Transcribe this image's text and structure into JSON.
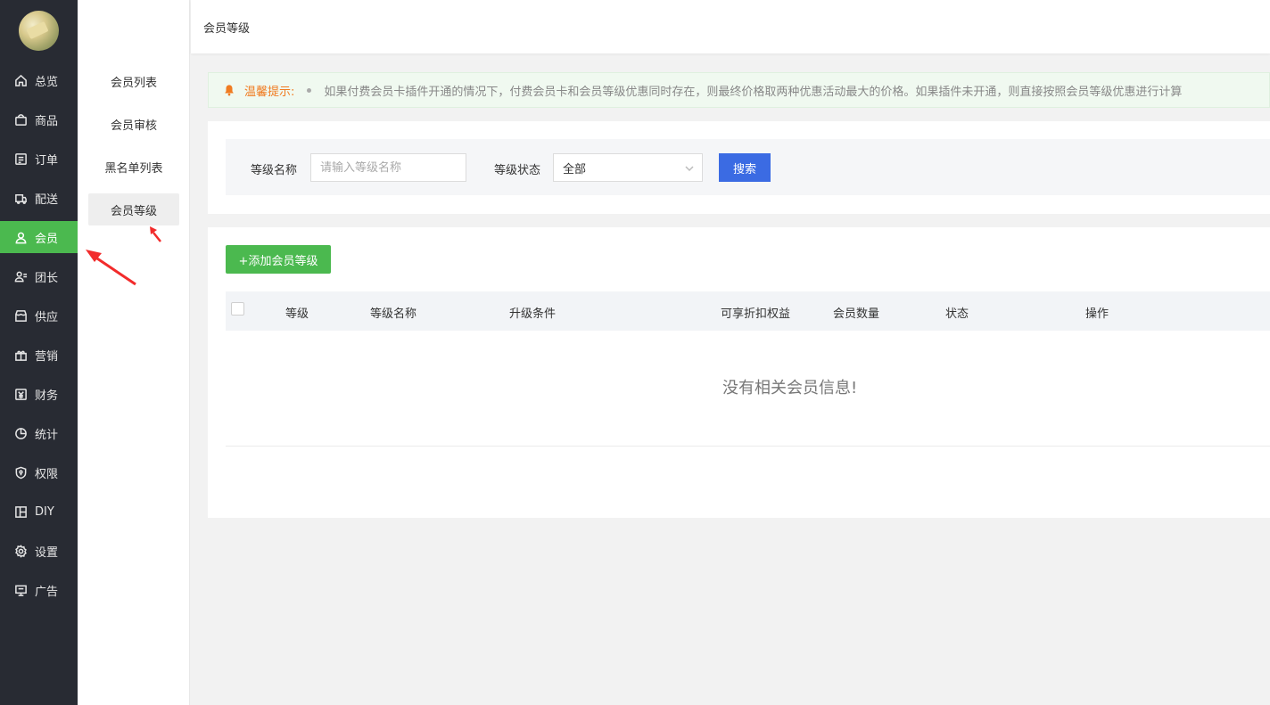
{
  "nav": {
    "items": [
      {
        "name": "overview",
        "label": "总览",
        "icon": "home-icon"
      },
      {
        "name": "goods",
        "label": "商品",
        "icon": "bag-icon"
      },
      {
        "name": "order",
        "label": "订单",
        "icon": "order-icon"
      },
      {
        "name": "delivery",
        "label": "配送",
        "icon": "delivery-icon"
      },
      {
        "name": "member",
        "label": "会员",
        "icon": "user-icon",
        "active": true
      },
      {
        "name": "leader",
        "label": "团长",
        "icon": "leader-icon"
      },
      {
        "name": "supply",
        "label": "供应",
        "icon": "store-icon"
      },
      {
        "name": "marketing",
        "label": "营销",
        "icon": "gift-icon"
      },
      {
        "name": "finance",
        "label": "财务",
        "icon": "yen-icon"
      },
      {
        "name": "stats",
        "label": "统计",
        "icon": "pie-icon"
      },
      {
        "name": "permission",
        "label": "权限",
        "icon": "shield-icon"
      },
      {
        "name": "diy",
        "label": "DIY",
        "icon": "layout-icon"
      },
      {
        "name": "settings",
        "label": "设置",
        "icon": "gear-icon"
      },
      {
        "name": "ads",
        "label": "广告",
        "icon": "monitor-icon"
      }
    ]
  },
  "submenu": {
    "items": [
      {
        "label": "会员列表"
      },
      {
        "label": "会员审核"
      },
      {
        "label": "黑名单列表"
      },
      {
        "label": "会员等级",
        "active": true
      }
    ]
  },
  "breadcrumb": "会员等级",
  "tip": {
    "label": "温馨提示:",
    "text": "如果付费会员卡插件开通的情况下，付费会员卡和会员等级优惠同时存在，则最终价格取两种优惠活动最大的价格。如果插件未开通，则直接按照会员等级优惠进行计算"
  },
  "filter": {
    "name_label": "等级名称",
    "name_placeholder": "请输入等级名称",
    "status_label": "等级状态",
    "status_value": "全部",
    "search_button": "搜索"
  },
  "list": {
    "add_button": "+添加会员等级",
    "columns": [
      "等级",
      "等级名称",
      "升级条件",
      "可享折扣权益",
      "会员数量",
      "状态",
      "操作"
    ],
    "empty_text": "没有相关会员信息!"
  },
  "colors": {
    "nav_bg": "#282b33",
    "accent_green": "#4bb94f",
    "primary_blue": "#3b6be3",
    "tip_orange": "#f07b21",
    "annotation_red": "#f22b2b"
  }
}
